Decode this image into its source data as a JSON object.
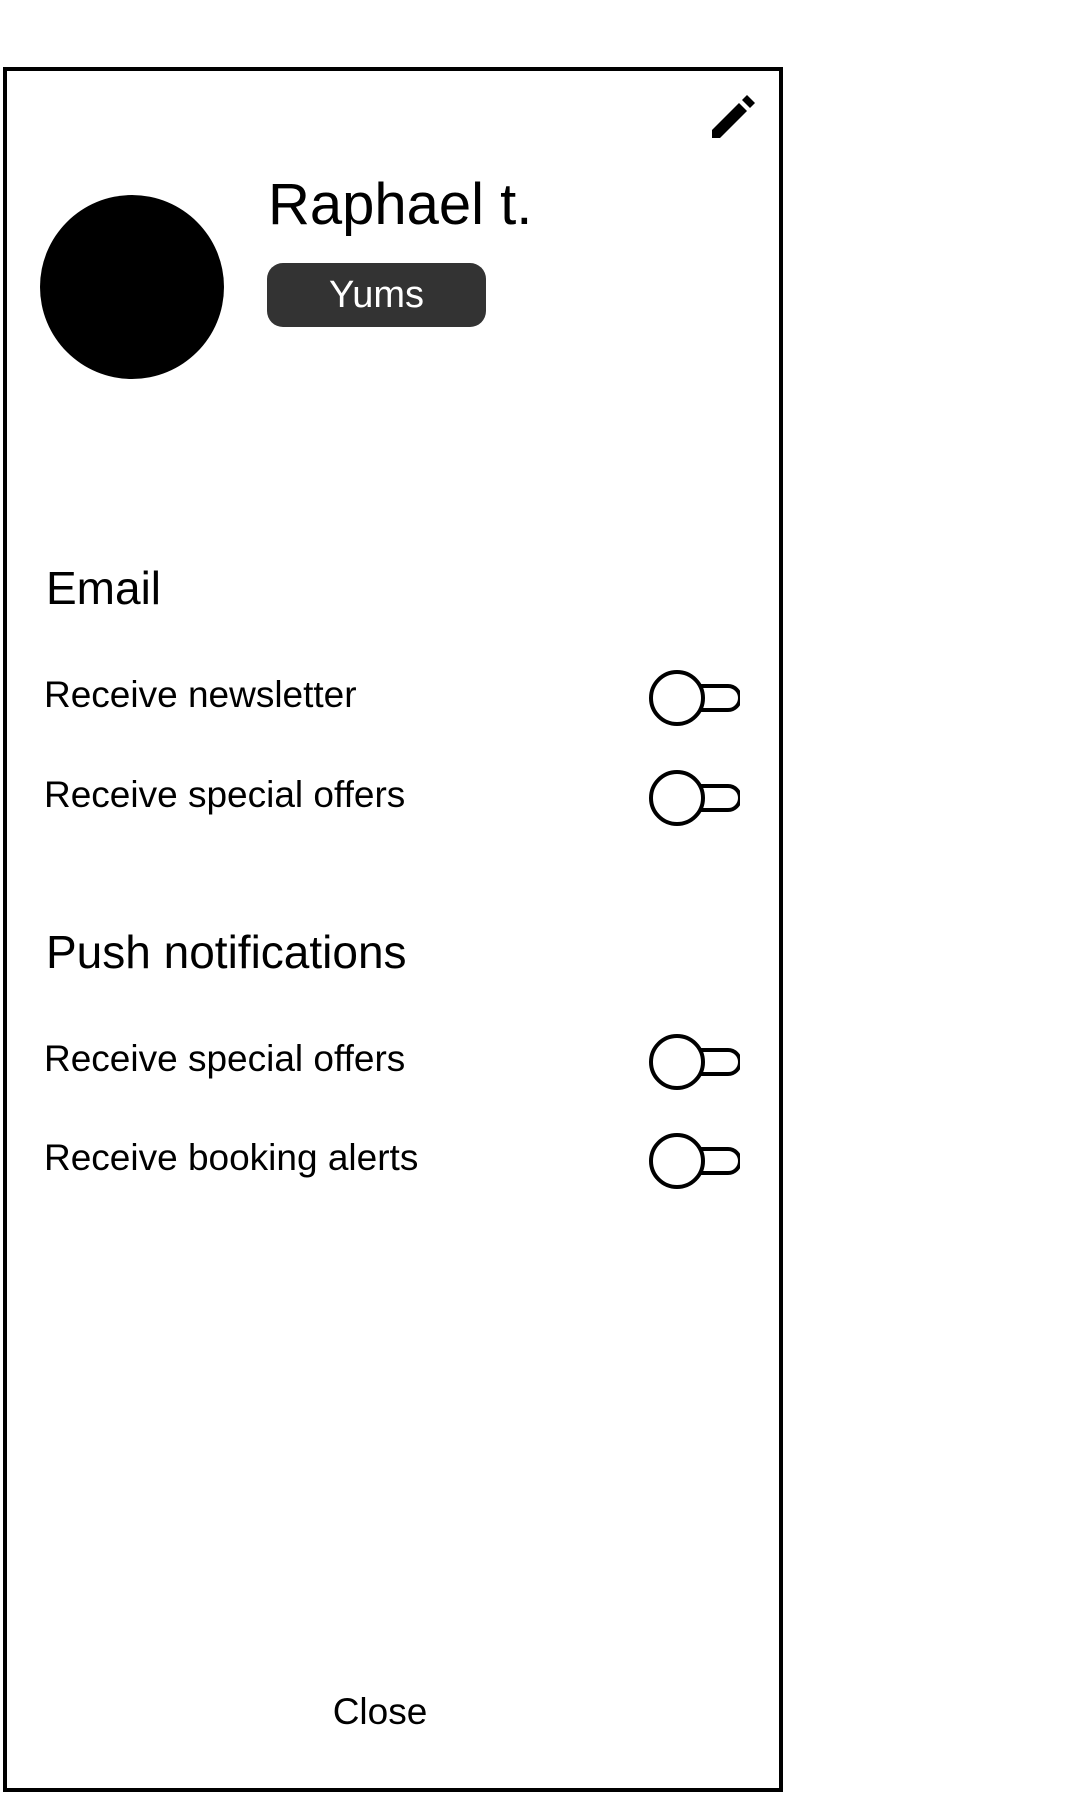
{
  "profile": {
    "name": "Raphael t.",
    "badge": "Yums"
  },
  "icons": {
    "edit": "pencil-icon",
    "avatar": "avatar-circle"
  },
  "sections": [
    {
      "heading": "Email",
      "settings": [
        {
          "label": "Receive newsletter",
          "enabled": false
        },
        {
          "label": "Receive special offers",
          "enabled": false
        }
      ]
    },
    {
      "heading": "Push notifications",
      "settings": [
        {
          "label": "Receive special offers",
          "enabled": false
        },
        {
          "label": "Receive booking alerts",
          "enabled": false
        }
      ]
    }
  ],
  "footer": {
    "close_label": "Close"
  },
  "colors": {
    "frame": "#000000",
    "badge_background": "#333333",
    "badge_text": "#ffffff"
  }
}
